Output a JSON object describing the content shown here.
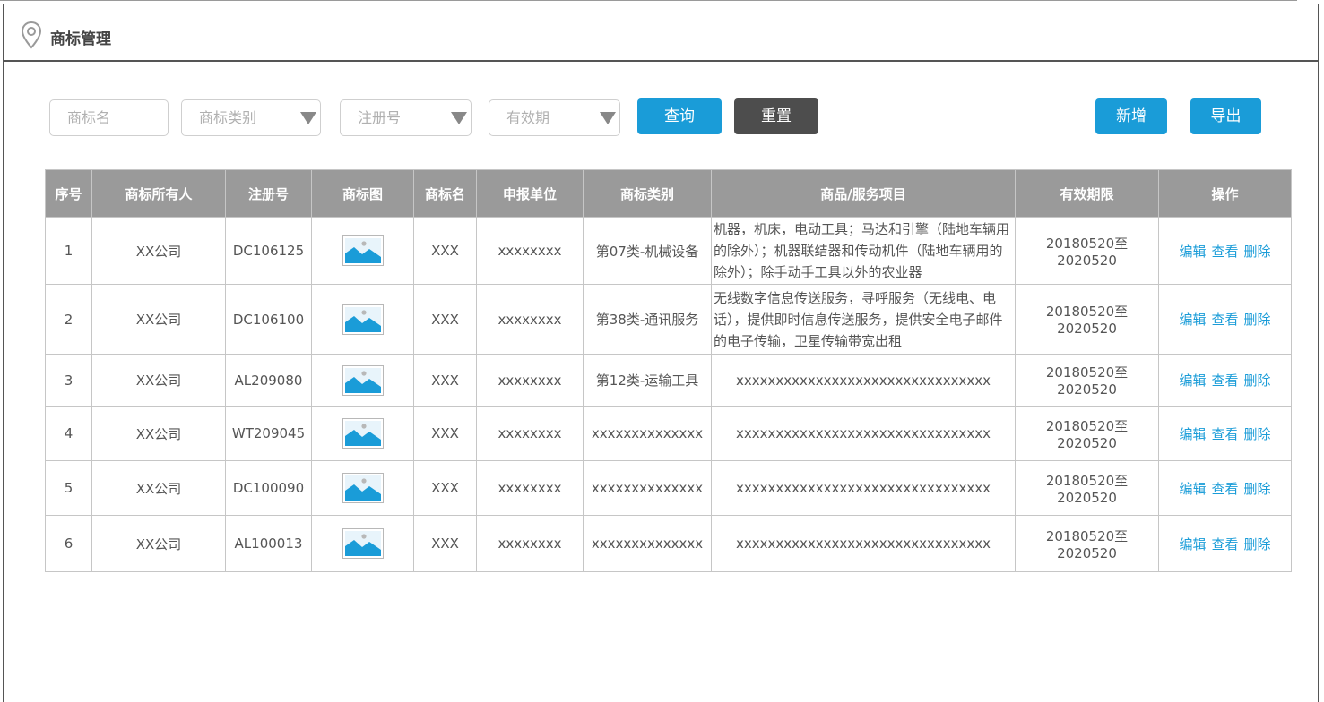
{
  "header": {
    "title": "商标管理",
    "icon": "location-pin-icon"
  },
  "filters": {
    "name_placeholder": "商标名",
    "category_placeholder": "商标类别",
    "regno_placeholder": "注册号",
    "validity_placeholder": "有效期"
  },
  "buttons": {
    "query": "查询",
    "reset": "重置",
    "add": "新增",
    "export": "导出"
  },
  "colors": {
    "accent": "#1a9cd8",
    "dark_button": "#4d4d4d",
    "header_bg": "#9a9a9a"
  },
  "table": {
    "columns": [
      "序号",
      "商标所有人",
      "注册号",
      "商标图",
      "商标名",
      "申报单位",
      "商标类别",
      "商品/服务项目",
      "有效期限",
      "操作"
    ],
    "actions": {
      "edit": "编辑",
      "view": "查看",
      "delete": "删除"
    },
    "rows": [
      {
        "index": "1",
        "owner": "XX公司",
        "regno": "DC106125",
        "name": "XXX",
        "unit": "xxxxxxxx",
        "category": "第07类-机械设备",
        "goods": "机器，机床，电动工具；马达和引擎（陆地车辆用的除外）；机器联结器和传动机件（陆地车辆用的除外）；除手动手工具以外的农业器",
        "validity": "20180520至2020520"
      },
      {
        "index": "2",
        "owner": "XX公司",
        "regno": "DC106100",
        "name": "XXX",
        "unit": "xxxxxxxx",
        "category": "第38类-通讯服务",
        "goods": "无线数字信息传送服务，寻呼服务（无线电、电话），提供即时信息传送服务，提供安全电子邮件的电子传输，卫星传输带宽出租",
        "validity": "20180520至2020520"
      },
      {
        "index": "3",
        "owner": "XX公司",
        "regno": "AL209080",
        "name": "XXX",
        "unit": "xxxxxxxx",
        "category": "第12类-运输工具",
        "goods": "xxxxxxxxxxxxxxxxxxxxxxxxxxxxxxxx",
        "validity": "20180520至2020520"
      },
      {
        "index": "4",
        "owner": "XX公司",
        "regno": "WT209045",
        "name": "XXX",
        "unit": "xxxxxxxx",
        "category": "xxxxxxxxxxxxxx",
        "goods": "xxxxxxxxxxxxxxxxxxxxxxxxxxxxxxxx",
        "validity": "20180520至2020520"
      },
      {
        "index": "5",
        "owner": "XX公司",
        "regno": "DC100090",
        "name": "XXX",
        "unit": "xxxxxxxx",
        "category": "xxxxxxxxxxxxxx",
        "goods": "xxxxxxxxxxxxxxxxxxxxxxxxxxxxxxxx",
        "validity": "20180520至2020520"
      },
      {
        "index": "6",
        "owner": "XX公司",
        "regno": "AL100013",
        "name": "XXX",
        "unit": "xxxxxxxx",
        "category": "xxxxxxxxxxxxxx",
        "goods": "xxxxxxxxxxxxxxxxxxxxxxxxxxxxxxxx",
        "validity": "20180520至2020520"
      }
    ]
  }
}
